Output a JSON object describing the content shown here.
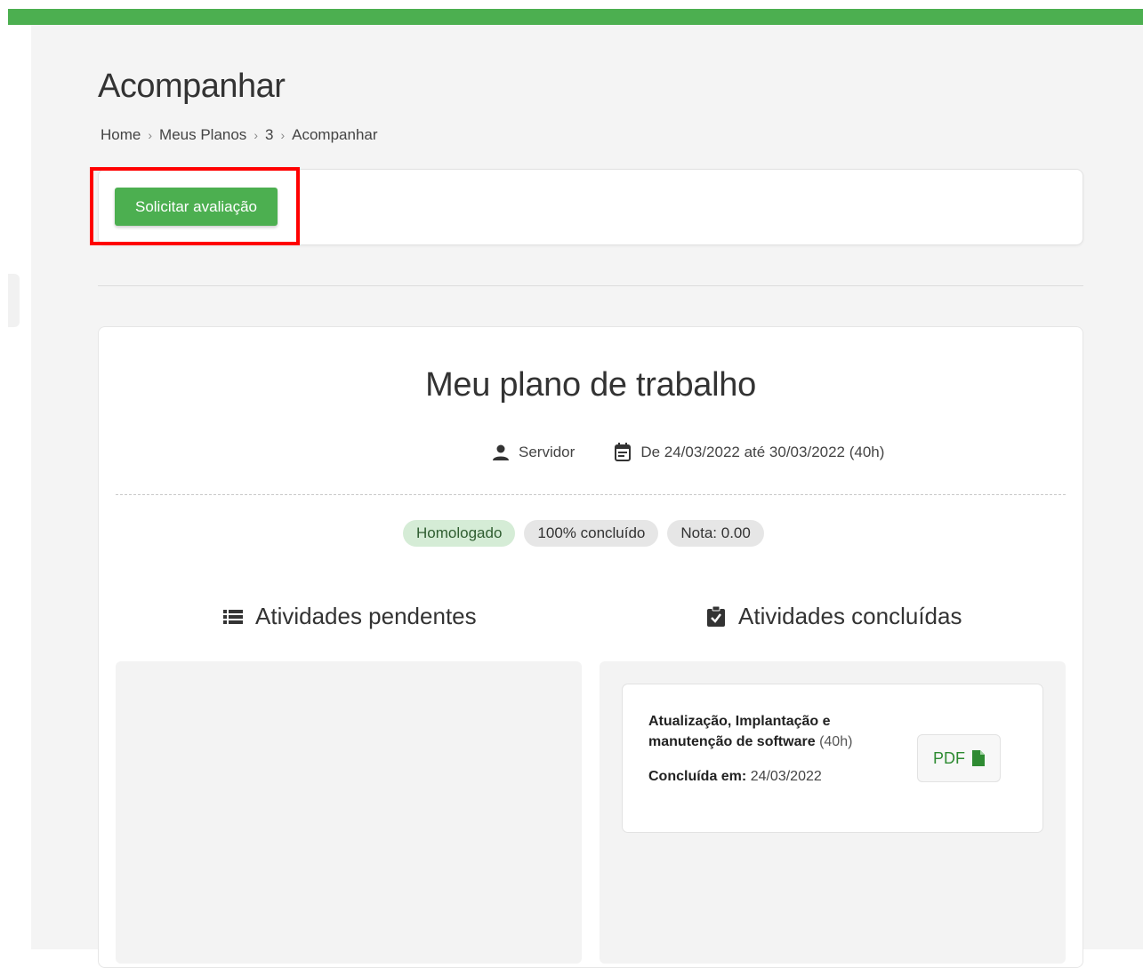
{
  "header": {
    "accent_color": "#4caf50"
  },
  "page": {
    "title": "Acompanhar",
    "breadcrumb": [
      "Home",
      "Meus Planos",
      "3",
      "Acompanhar"
    ]
  },
  "actions": {
    "request_evaluation_label": "Solicitar avaliação"
  },
  "plan": {
    "title": "Meu plano de trabalho",
    "role": "Servidor",
    "period": "De 24/03/2022 até 30/03/2022 (40h)",
    "badges": [
      "Homologado",
      "100% concluído",
      "Nota: 0.00"
    ]
  },
  "columns": {
    "pending_title": "Atividades pendentes",
    "completed_title": "Atividades concluídas"
  },
  "completed_activities": [
    {
      "name": "Atualização, Implantação e manutenção de software",
      "hours": "(40h)",
      "completed_label": "Concluída em:",
      "completed_date": "24/03/2022",
      "pdf_label": "PDF"
    }
  ],
  "icons": {
    "role": "person-icon",
    "period": "calendar-icon",
    "pending": "list-icon",
    "completed": "clipboard-check-icon",
    "pdf": "file-icon"
  }
}
